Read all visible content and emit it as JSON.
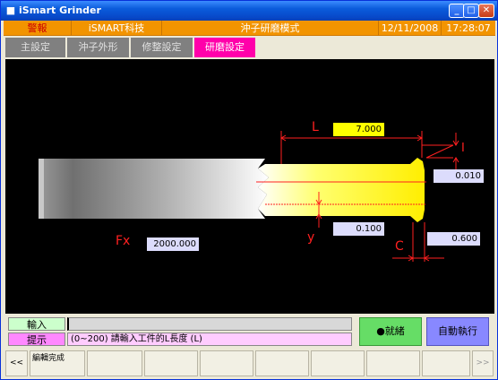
{
  "window": {
    "title": "iSmart Grinder",
    "controls": {
      "minimize": "_",
      "maximize": "□",
      "close": "✕"
    }
  },
  "header": {
    "alarm": "警報",
    "company": "iSMART科技",
    "mode": "沖子研磨模式",
    "date": "12/11/2008",
    "time": "17:28:07"
  },
  "tabs": [
    {
      "label": "主設定",
      "active": false
    },
    {
      "label": "沖子外形",
      "active": false
    },
    {
      "label": "修整設定",
      "active": false
    },
    {
      "label": "研磨設定",
      "active": true
    }
  ],
  "drawing": {
    "labels": {
      "L": "L",
      "I": "I",
      "Fx": "Fx",
      "y": "y",
      "C": "C"
    },
    "values": {
      "L": "7.000",
      "I": "0.010",
      "Fx": "2000.000",
      "y": "0.100",
      "C": "0.600"
    }
  },
  "input": {
    "input_label": "輸入",
    "input_value": "",
    "hint_label": "提示",
    "hint_text": "(0~200) 請輸入工件的L長度 (L)"
  },
  "buttons": {
    "ready": "●就緒",
    "auto_run": "自動執行"
  },
  "bottombar": {
    "prev": "<<",
    "edit_done": "編輯完成",
    "next": ">>"
  },
  "colors": {
    "header_bg": "#f29400",
    "tab_active": "#ff00aa",
    "tab_inactive": "#808080",
    "dim_lines": "#ff2020",
    "ready_bg": "#66dd66",
    "auto_bg": "#8888ff"
  }
}
